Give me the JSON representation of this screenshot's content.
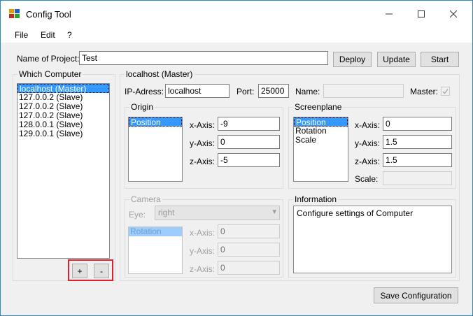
{
  "window": {
    "title": "Config Tool"
  },
  "menu": [
    "File",
    "Edit",
    "?"
  ],
  "project": {
    "name_label": "Name of Project:",
    "name_value": "Test",
    "deploy": "Deploy",
    "update": "Update",
    "start": "Start"
  },
  "computers": {
    "title": "Which Computer",
    "items": [
      "localhost (Master)",
      "127.0.0.2 (Slave)",
      "127.0.0.2 (Slave)",
      "127.0.0.2 (Slave)",
      "128.0.0.1 (Slave)",
      "129.0.0.1 (Slave)"
    ],
    "add": "+",
    "remove": "-"
  },
  "config": {
    "title": "localhost (Master)",
    "ip_label": "IP-Adress:",
    "ip_value": "localhost",
    "port_label": "Port:",
    "port_value": "25000",
    "name_label": "Name:",
    "name_value": "",
    "master_label": "Master:"
  },
  "origin": {
    "title": "Origin",
    "list": [
      "Position"
    ],
    "x_label": "x-Axis:",
    "x_value": "-9",
    "y_label": "y-Axis:",
    "y_value": "0",
    "z_label": "z-Axis:",
    "z_value": "-5"
  },
  "screenplane": {
    "title": "Screenplane",
    "list": [
      "Position",
      "Rotation",
      "Scale"
    ],
    "x_label": "x-Axis:",
    "x_value": "0",
    "y_label": "y-Axis:",
    "y_value": "1.5",
    "z_label": "z-Axis:",
    "z_value": "1.5",
    "scale_label": "Scale:",
    "scale_value": ""
  },
  "camera": {
    "title": "Camera",
    "eye_label": "Eye:",
    "eye_value": "right",
    "list": [
      "Rotation"
    ],
    "x_label": "x-Axis:",
    "x_value": "0",
    "y_label": "y-Axis:",
    "y_value": "0",
    "z_label": "z-Axis:",
    "z_value": "0"
  },
  "information": {
    "title": "Information",
    "text": "Configure settings of Computer"
  },
  "save": "Save Configuration",
  "colors": {
    "selection": "#3399ff",
    "highlight": "#e0202a",
    "border": "#2b8ac4"
  }
}
